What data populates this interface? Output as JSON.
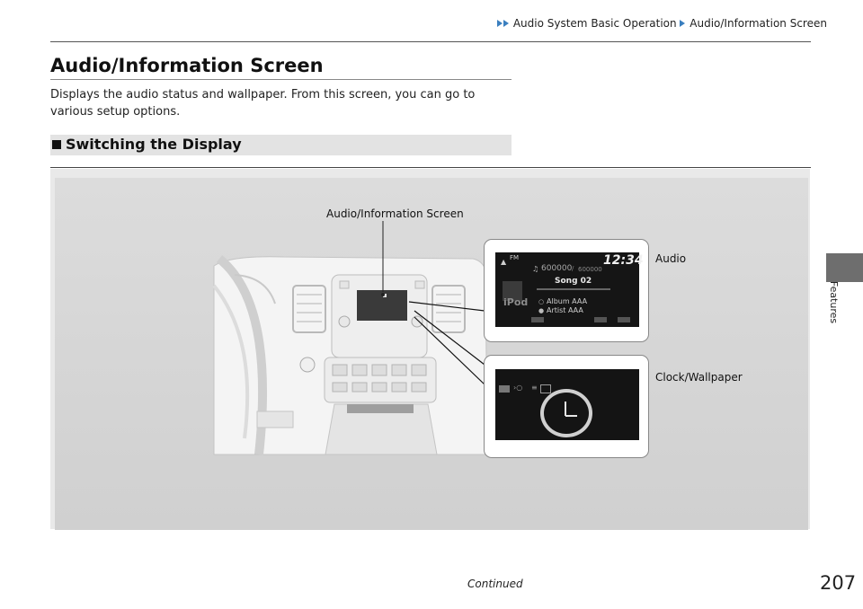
{
  "breadcrumb": {
    "items": [
      "Audio System Basic Operation",
      "Audio/Information Screen"
    ]
  },
  "page_title": "Audio/Information Screen",
  "description": "Displays the audio status and wallpaper. From this screen, you can go to various setup options.",
  "section": {
    "heading": "Switching the Display"
  },
  "figure": {
    "callout_screen": "Audio/Information Screen",
    "callout_audio": "Audio",
    "callout_clock": "Clock/Wallpaper",
    "audio_screen": {
      "band": "FM",
      "time": "12:34",
      "counter": "600000",
      "counter_total": "600000",
      "song": "Song 02",
      "source_logo": "iPod",
      "album": "Album AAA",
      "artist": "Artist AAA",
      "icons": [
        "signal-icon",
        "music-note-icon",
        "album-icon",
        "artist-icon"
      ]
    },
    "clock_screen": {
      "icons": [
        "menu-icon",
        "clock-icon",
        "settings-icon",
        "wallpaper-icon"
      ]
    }
  },
  "side_tab": {
    "label": "Features"
  },
  "footer": {
    "continued": "Continued",
    "page_number": "207"
  },
  "colors": {
    "accent_arrow": "#3a7fbf",
    "side_tab": "#6e6e6e",
    "section_bg": "#e3e3e3",
    "figure_bg": "#d6d6d6"
  }
}
